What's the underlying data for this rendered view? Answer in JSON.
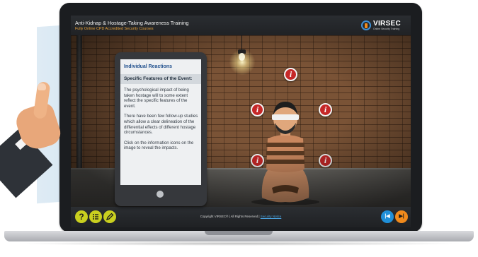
{
  "header": {
    "title": "Anti-Kidnap & Hostage-Taking Awareness Training",
    "subtitle": "Fully Online CPD Accredited Security Courses"
  },
  "logo": {
    "word": "VIRSEC",
    "tagline": "Online Security Training"
  },
  "tablet": {
    "title": "Individual Reactions",
    "subtitle": "Specific Features of the Event:",
    "paragraphs": [
      "The psychological impact of being taken hostage will to some extent reflect the specific features of the event.",
      "There have been few follow-up studies which allow a clear delineation of the differential effects of different hostage circumstances.",
      "Click on the information icons on the image to reveal the impacts."
    ]
  },
  "info_icons": [
    "i",
    "i",
    "i",
    "i",
    "i"
  ],
  "footer": {
    "copyright": "Copyright VIRSEC® | All Rights Reserved | ",
    "policy_link": "Security Notice",
    "help_label": "?",
    "back_label": "|◀",
    "next_label": "▶|"
  },
  "icons": {
    "help": "help-icon",
    "menu": "menu-list-icon",
    "notes": "pencil-icon",
    "back": "skip-back-icon",
    "next": "skip-next-icon",
    "info": "info-icon"
  },
  "colors": {
    "accent_yellow": "#c9cf1f",
    "accent_blue": "#1f8fd8",
    "accent_orange": "#f08a1c",
    "info_red": "#c62828",
    "subtitle_orange": "#e7a13a",
    "tablet_title_blue": "#1e4e8c"
  }
}
